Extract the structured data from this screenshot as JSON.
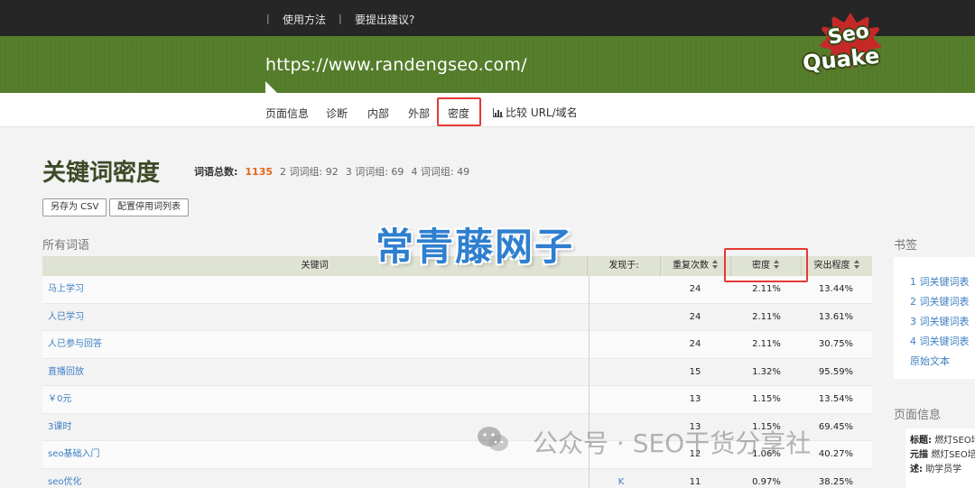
{
  "topbar": {
    "links": [
      "使用方法",
      "要提出建议?"
    ]
  },
  "header": {
    "url": "https://www.randengseo.com/",
    "logo_top": "Seo",
    "logo_bottom": "Quake"
  },
  "nav": {
    "tabs": [
      "页面信息",
      "诊断",
      "内部",
      "外部",
      "密度"
    ],
    "compare": "比较 URL/域名",
    "active": "密度"
  },
  "page": {
    "title": "关键词密度",
    "stats_label": "词语总数:",
    "total": "1135",
    "groups": [
      "2 词词组: 92",
      "3 词词组: 69",
      "4 词词组: 49"
    ],
    "buttons": [
      "另存为 CSV",
      "配置停用词列表"
    ],
    "section_label": "所有词语",
    "watermark": "常青藤网子"
  },
  "table": {
    "headers": {
      "keyword": "关键词",
      "found": "发现于:",
      "repeat": "重复次数",
      "density": "密度",
      "prominence": "突出程度"
    },
    "rows": [
      {
        "keyword": "马上学习",
        "found": "",
        "repeat": "24",
        "density": "2.11%",
        "prominence": "13.44%"
      },
      {
        "keyword": "人已学习",
        "found": "",
        "repeat": "24",
        "density": "2.11%",
        "prominence": "13.61%"
      },
      {
        "keyword": "人已参与回答",
        "found": "",
        "repeat": "24",
        "density": "2.11%",
        "prominence": "30.75%"
      },
      {
        "keyword": "直播回放",
        "found": "",
        "repeat": "15",
        "density": "1.32%",
        "prominence": "95.59%"
      },
      {
        "keyword": "￥0元",
        "found": "",
        "repeat": "13",
        "density": "1.15%",
        "prominence": "13.54%"
      },
      {
        "keyword": "3课时",
        "found": "",
        "repeat": "13",
        "density": "1.15%",
        "prominence": "69.45%"
      },
      {
        "keyword": "seo基础入门",
        "found": "",
        "repeat": "12",
        "density": "1.06%",
        "prominence": "40.27%"
      },
      {
        "keyword": "seo优化",
        "found": "K",
        "repeat": "11",
        "density": "0.97%",
        "prominence": "38.25%"
      }
    ]
  },
  "sidebar": {
    "bookmarks_title": "书签",
    "links": [
      "1 词关键词表",
      "2 词关键词表",
      "3 词关键词表",
      "4 词关键词表",
      "原始文本"
    ],
    "page_info_title": "页面信息",
    "page_info": [
      {
        "label": "标题:",
        "value": "燃灯SEO培"
      },
      {
        "label": "元描",
        "value": "燃灯SEO培"
      },
      {
        "label": "述:",
        "value": "助学员学"
      }
    ]
  },
  "wechat_watermark": "公众号 · SEO干货分享社",
  "colors": {
    "header_green": "#567f2c",
    "link_blue": "#3d7fc4",
    "highlight_red": "#e53935",
    "total_orange": "#e0661e"
  }
}
